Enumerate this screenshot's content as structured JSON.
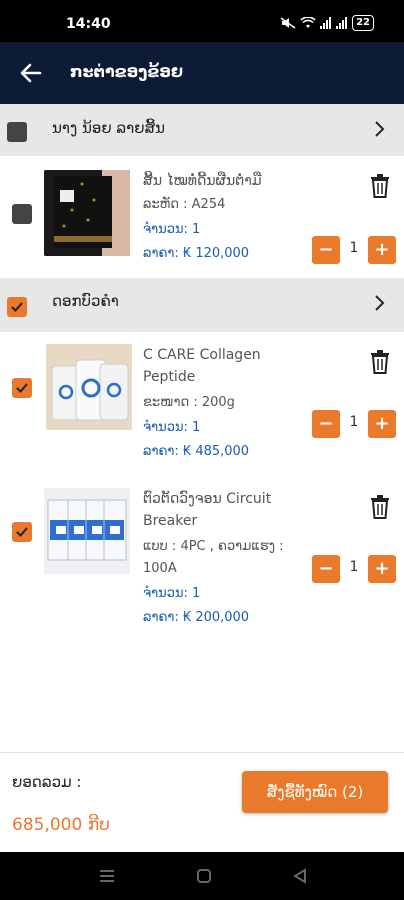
{
  "status_bar": {
    "time": "14:40",
    "battery": "22"
  },
  "app_bar": {
    "title": "ກະຕ່າຂອງຂ້ອຍ"
  },
  "stores": [
    {
      "name": "ນາງ ນ້ອຍ ລາຍສິ້ນ",
      "checked": false,
      "items": [
        {
          "name": "ສິ້ນ ໄໝທໍ່ດີ້ນຜືນຕໍ່າມື",
          "variant": "ລະຫັດ : A254",
          "qty_label": "ຈຳນວນ: 1",
          "price": "ລາຄາ: ₭ 120,000",
          "qty": "1",
          "checked": false
        }
      ]
    },
    {
      "name": "ດອກບົວຄຳ",
      "checked": true,
      "items": [
        {
          "name": "C CARE Collagen Peptide",
          "variant": "ຂະໜາດ : 200g",
          "qty_label": "ຈຳນວນ: 1",
          "price": "ລາຄາ: ₭ 485,000",
          "qty": "1",
          "checked": true
        },
        {
          "name": "ຕົວຕັດວົງຈອນ Circuit Breaker",
          "variant": "ແບບ : 4PC , ຄວາມແຮງ : 100A",
          "qty_label": "ຈຳນວນ: 1",
          "price": "ລາຄາ: ₭ 200,000",
          "qty": "1",
          "checked": true
        }
      ]
    }
  ],
  "footer": {
    "total_label": "ຍອດລວມ :",
    "total_value": "685,000 ກີບ",
    "order_button": "ສັ່ງຊື້ທັງໝົດ (2)"
  },
  "colors": {
    "accent": "#e9792b",
    "header": "#0e1b36",
    "link": "#1a5fb4"
  },
  "icons": {
    "back": "arrow-left",
    "trash": "trash-can",
    "chevron": "chevron-right"
  }
}
